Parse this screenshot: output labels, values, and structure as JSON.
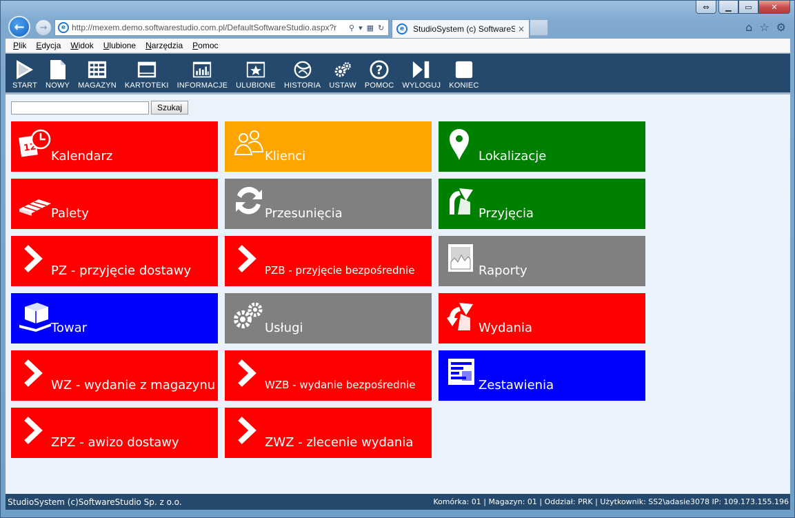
{
  "window": {
    "minimize": "▭",
    "restore": "▭",
    "close": "✕"
  },
  "browser": {
    "address_url": "http://mexem.demo.softwarestudio.com.pl/DefaultSoftwareStudio.aspx?r",
    "tab_title": "StudioSystem (c) SoftwareS...",
    "tab_close": "×"
  },
  "menubar": {
    "items": [
      "Plik",
      "Edycja",
      "Widok",
      "Ulubione",
      "Narzędzia",
      "Pomoc"
    ]
  },
  "toolbar": {
    "items": [
      {
        "label": "START",
        "icon": "play-icon"
      },
      {
        "label": "NOWY",
        "icon": "document-icon"
      },
      {
        "label": "MAGAZYN",
        "icon": "grid-icon"
      },
      {
        "label": "KARTOTEKI",
        "icon": "window-icon"
      },
      {
        "label": "INFORMACJE",
        "icon": "bar-chart-icon"
      },
      {
        "label": "ULUBIONE",
        "icon": "star-icon"
      },
      {
        "label": "HISTORIA",
        "icon": "history-icon"
      },
      {
        "label": "USTAW",
        "icon": "gears-icon"
      },
      {
        "label": "POMOC",
        "icon": "help-icon"
      },
      {
        "label": "WYLOGUJ",
        "icon": "logout-icon"
      },
      {
        "label": "KONIEC",
        "icon": "stop-icon"
      }
    ]
  },
  "search": {
    "value": "",
    "button_label": "Szukaj"
  },
  "tiles": [
    {
      "label": "Kalendarz",
      "color": "#ff0000",
      "icon": "calendar-clock-icon"
    },
    {
      "label": "Klienci",
      "color": "#ffa500",
      "icon": "people-icon"
    },
    {
      "label": "Lokalizacje",
      "color": "#008000",
      "icon": "location-pin-icon"
    },
    {
      "label": "Palety",
      "color": "#ff0000",
      "icon": "pallet-icon"
    },
    {
      "label": "Przesunięcia",
      "color": "#808080",
      "icon": "transfer-icon"
    },
    {
      "label": "Przyjęcia",
      "color": "#008000",
      "icon": "receipt-icon"
    },
    {
      "label": "PZ - przyjęcie dostawy",
      "color": "#ff0000",
      "icon": "chevron-right-icon"
    },
    {
      "label": "PZB - przyjęcie bezpośrednie",
      "color": "#ff0000",
      "icon": "chevron-right-icon"
    },
    {
      "label": "Raporty",
      "color": "#808080",
      "icon": "report-icon"
    },
    {
      "label": "Towar",
      "color": "#0000ff",
      "icon": "goods-icon"
    },
    {
      "label": "Usługi",
      "color": "#808080",
      "icon": "gears-icon"
    },
    {
      "label": "Wydania",
      "color": "#ff0000",
      "icon": "issue-icon"
    },
    {
      "label": "WZ - wydanie z magazynu",
      "color": "#ff0000",
      "icon": "chevron-right-icon"
    },
    {
      "label": "WZB - wydanie bezpośrednie",
      "color": "#ff0000",
      "icon": "chevron-right-icon"
    },
    {
      "label": "Zestawienia",
      "color": "#0000ff",
      "icon": "list-report-icon"
    },
    {
      "label": "ZPZ - awizo dostawy",
      "color": "#ff0000",
      "icon": "chevron-right-icon"
    },
    {
      "label": "ZWZ - zlecenie wydania",
      "color": "#ff0000",
      "icon": "chevron-right-icon"
    }
  ],
  "status": {
    "left": "StudioSystem (c)SoftwareStudio Sp. z o.o.",
    "right": "Komórka: 01 | Magazyn: 01 | Oddział: PRK | Użytkownik: SS2\\adasie3078 IP: 109.173.155.196"
  }
}
